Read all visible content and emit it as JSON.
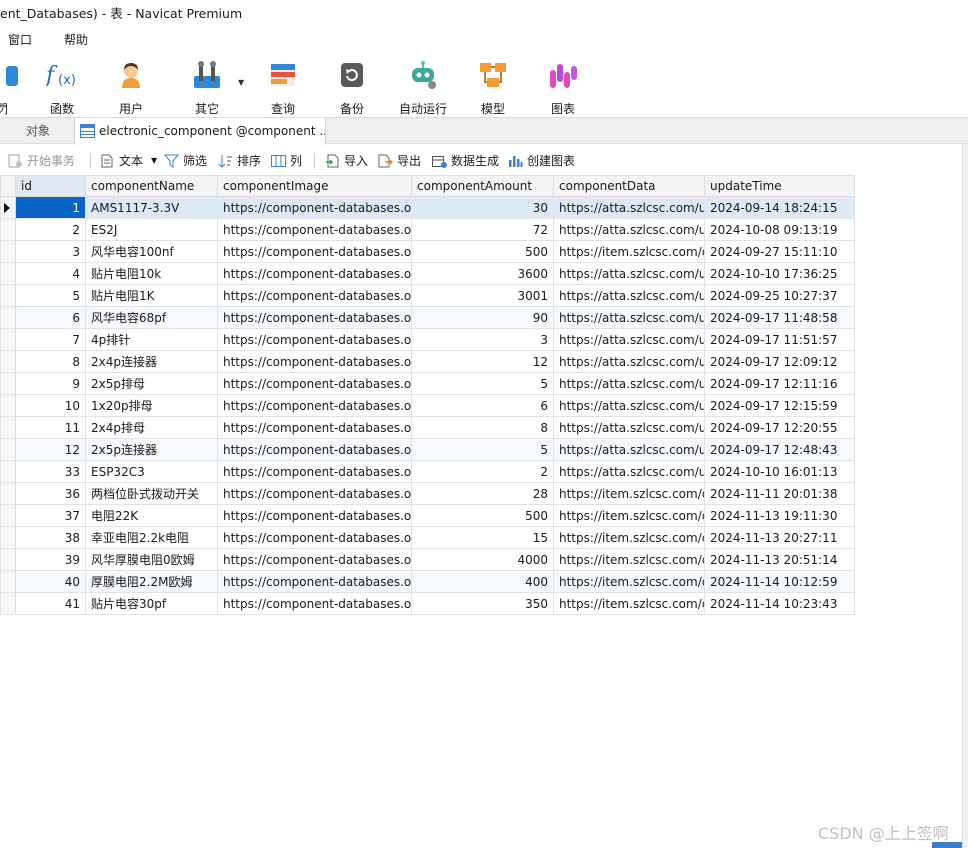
{
  "window": {
    "title": "ent_Databases) - 表 - Navicat Premium"
  },
  "menu": [
    {
      "label": "窗口"
    },
    {
      "label": "帮助"
    }
  ],
  "ribbon": [
    {
      "label": "閁",
      "icon": "partial-icon"
    },
    {
      "label": "函数",
      "icon": "function-icon"
    },
    {
      "label": "用户",
      "icon": "user-icon"
    },
    {
      "label": "其它",
      "icon": "tools-icon"
    },
    {
      "label": "查询",
      "icon": "query-icon"
    },
    {
      "label": "备份",
      "icon": "backup-icon"
    },
    {
      "label": "自动运行",
      "icon": "robot-icon"
    },
    {
      "label": "模型",
      "icon": "model-icon"
    },
    {
      "label": "图表",
      "icon": "chart-icon"
    }
  ],
  "tabs": {
    "objects": "对象",
    "active": "electronic_component @component ..."
  },
  "toolbar": {
    "begin_transaction": "开始事务",
    "text": "文本",
    "filter": "筛选",
    "sort": "排序",
    "columns": "列",
    "import": "导入",
    "export": "导出",
    "generate_data": "数据生成",
    "create_chart": "创建图表"
  },
  "table": {
    "columns": [
      "id",
      "componentName",
      "componentImage",
      "componentAmount",
      "componentData",
      "updateTime"
    ],
    "rows": [
      {
        "id": "1",
        "name": "AMS1117-3.3V",
        "image": "https://component-databases.o",
        "amount": "30",
        "data": "https://atta.szlcsc.com/u",
        "time": "2024-09-14 18:24:15"
      },
      {
        "id": "2",
        "name": "ES2J",
        "image": "https://component-databases.o",
        "amount": "72",
        "data": "https://atta.szlcsc.com/u",
        "time": "2024-10-08 09:13:19"
      },
      {
        "id": "3",
        "name": "风华电容100nf",
        "image": "https://component-databases.o",
        "amount": "500",
        "data": "https://item.szlcsc.com/c",
        "time": "2024-09-27 15:11:10"
      },
      {
        "id": "4",
        "name": "贴片电阻10k",
        "image": "https://component-databases.o",
        "amount": "3600",
        "data": "https://atta.szlcsc.com/u",
        "time": "2024-10-10 17:36:25"
      },
      {
        "id": "5",
        "name": "贴片电阻1K",
        "image": "https://component-databases.o",
        "amount": "3001",
        "data": "https://atta.szlcsc.com/u",
        "time": "2024-09-25 10:27:37"
      },
      {
        "id": "6",
        "name": "风华电容68pf",
        "image": "https://component-databases.o",
        "amount": "90",
        "data": "https://atta.szlcsc.com/u",
        "time": "2024-09-17 11:48:58"
      },
      {
        "id": "7",
        "name": "4p排针",
        "image": "https://component-databases.o",
        "amount": "3",
        "data": "https://atta.szlcsc.com/u",
        "time": "2024-09-17 11:51:57"
      },
      {
        "id": "8",
        "name": "2x4p连接器",
        "image": "https://component-databases.o",
        "amount": "12",
        "data": "https://atta.szlcsc.com/u",
        "time": "2024-09-17 12:09:12"
      },
      {
        "id": "9",
        "name": "2x5p排母",
        "image": "https://component-databases.o",
        "amount": "5",
        "data": "https://atta.szlcsc.com/u",
        "time": "2024-09-17 12:11:16"
      },
      {
        "id": "10",
        "name": "1x20p排母",
        "image": "https://component-databases.o",
        "amount": "6",
        "data": "https://atta.szlcsc.com/u",
        "time": "2024-09-17 12:15:59"
      },
      {
        "id": "11",
        "name": "2x4p排母",
        "image": "https://component-databases.o",
        "amount": "8",
        "data": "https://atta.szlcsc.com/u",
        "time": "2024-09-17 12:20:55"
      },
      {
        "id": "12",
        "name": "2x5p连接器",
        "image": "https://component-databases.o",
        "amount": "5",
        "data": "https://atta.szlcsc.com/u",
        "time": "2024-09-17 12:48:43"
      },
      {
        "id": "33",
        "name": "ESP32C3",
        "image": "https://component-databases.o",
        "amount": "2",
        "data": "https://atta.szlcsc.com/u",
        "time": "2024-10-10 16:01:13"
      },
      {
        "id": "36",
        "name": "两档位卧式拨动开关",
        "image": "https://component-databases.o",
        "amount": "28",
        "data": "https://item.szlcsc.com/c",
        "time": "2024-11-11 20:01:38"
      },
      {
        "id": "37",
        "name": "电阻22K",
        "image": "https://component-databases.o",
        "amount": "500",
        "data": "https://item.szlcsc.com/c",
        "time": "2024-11-13 19:11:30"
      },
      {
        "id": "38",
        "name": "幸亚电阻2.2k电阻",
        "image": "https://component-databases.o",
        "amount": "15",
        "data": "https://item.szlcsc.com/c",
        "time": "2024-11-13 20:27:11"
      },
      {
        "id": "39",
        "name": "风华厚膜电阻0欧姆",
        "image": "https://component-databases.o",
        "amount": "4000",
        "data": "https://item.szlcsc.com/c",
        "time": "2024-11-13 20:51:14"
      },
      {
        "id": "40",
        "name": "厚膜电阻2.2M欧姆",
        "image": "https://component-databases.o",
        "amount": "400",
        "data": "https://item.szlcsc.com/c",
        "time": "2024-11-14 10:12:59"
      },
      {
        "id": "41",
        "name": "贴片电容30pf",
        "image": "https://component-databases.o",
        "amount": "350",
        "data": "https://item.szlcsc.com/c",
        "time": "2024-11-14 10:23:43"
      }
    ]
  },
  "watermark": "CSDN @上上签啊",
  "colors": {
    "selection": "#0a64c8",
    "accent": "#1e88e5"
  }
}
